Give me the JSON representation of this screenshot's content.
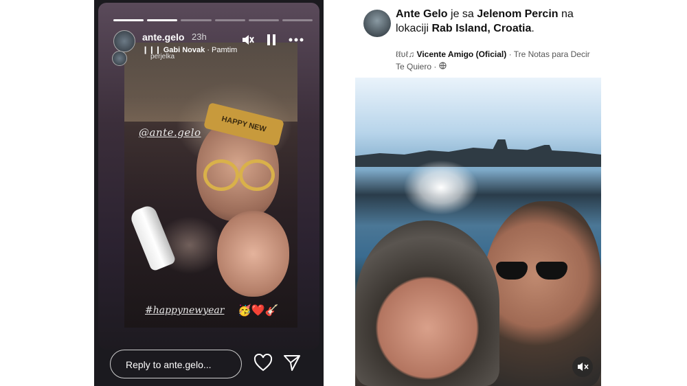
{
  "story": {
    "username": "ante.gelo",
    "time": "23h",
    "music_song": "Gabi Novak",
    "music_rest": "· Pamtim",
    "collaborator": "perjelka",
    "mention": "@ante.gelo",
    "hashtag": "#happynewyear",
    "emojis": "🥳❤️🎸",
    "hat_text": "HAPPY NEW",
    "reply_placeholder": "Reply to ante.gelo...",
    "progress_total": 6,
    "progress_done": 2
  },
  "post": {
    "author": "Ante Gelo",
    "text_with": "je sa",
    "tagged": "Jelenom Percin",
    "text_loc": "na lokaciji",
    "location": "Rab Island, Croatia",
    "music_artist": "Vicente Amigo (Oficial)",
    "music_song": "· Tre Notas para Decir Te Quiero ·",
    "music_icon_text": "ℓℓʋℓ♫"
  }
}
